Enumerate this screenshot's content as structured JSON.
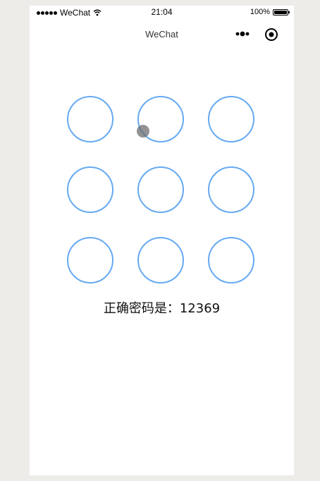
{
  "status_bar": {
    "carrier": "WeChat",
    "time": "21:04",
    "battery_percent": "100%",
    "battery_level": 1.0,
    "icons": [
      "signal-dots-icon",
      "wifi-icon",
      "battery-icon"
    ]
  },
  "nav_bar": {
    "title": "WeChat",
    "icons": [
      "more-dots-icon",
      "close-target-icon"
    ]
  },
  "pattern_lock": {
    "nodes": [
      1,
      2,
      3,
      4,
      5,
      6,
      7,
      8,
      9
    ],
    "node_color": "#66aaf2",
    "hint": "正确密码是：12369"
  }
}
